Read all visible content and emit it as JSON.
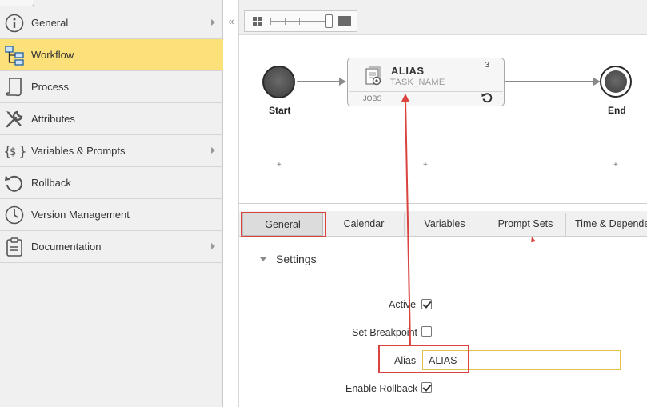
{
  "sidebar": {
    "items": [
      {
        "label": "General",
        "icon": "info-icon",
        "arrow": true,
        "active": false
      },
      {
        "label": "Workflow",
        "icon": "workflow-icon",
        "arrow": false,
        "active": true
      },
      {
        "label": "Process",
        "icon": "process-icon",
        "arrow": false,
        "active": false
      },
      {
        "label": "Attributes",
        "icon": "wrench-icon",
        "arrow": false,
        "active": false
      },
      {
        "label": "Variables & Prompts",
        "icon": "variables-icon",
        "arrow": true,
        "active": false
      },
      {
        "label": "Rollback",
        "icon": "rollback-icon",
        "arrow": false,
        "active": false
      },
      {
        "label": "Version Management",
        "icon": "clock-icon",
        "arrow": false,
        "active": false
      },
      {
        "label": "Documentation",
        "icon": "clipboard-icon",
        "arrow": true,
        "active": false
      }
    ],
    "colors": {
      "active_bg": "#fce17a",
      "bg": "#f0f0f0"
    }
  },
  "splitter": {
    "collapse_glyph": "«"
  },
  "workflow": {
    "start_label": "Start",
    "end_label": "End",
    "task": {
      "alias": "ALIAS",
      "name": "TASK_NAME",
      "count": "3",
      "type": "JOBS"
    },
    "plus_glyph": "+"
  },
  "tabs": [
    {
      "label": "General",
      "active": true
    },
    {
      "label": "Calendar",
      "active": false
    },
    {
      "label": "Variables",
      "active": false
    },
    {
      "label": "Prompt Sets",
      "active": false
    },
    {
      "label": "Time & Dependencies",
      "active": false
    }
  ],
  "settings": {
    "title": "Settings",
    "active_label": "Active",
    "active_checked": true,
    "breakpoint_label": "Set Breakpoint",
    "breakpoint_checked": false,
    "alias_label": "Alias",
    "alias_value": "ALIAS",
    "rollback_label": "Enable Rollback",
    "rollback_checked": true
  },
  "annotation_color": "#d9443f"
}
